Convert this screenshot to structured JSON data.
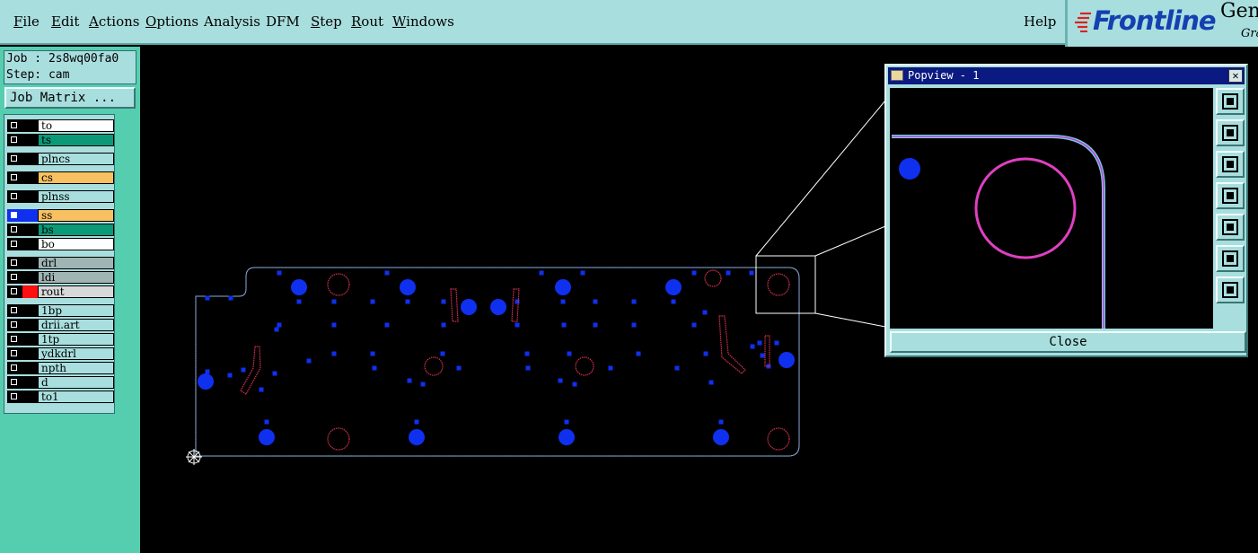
{
  "menu": {
    "items": [
      {
        "label": "File",
        "key": "F"
      },
      {
        "label": "Edit",
        "key": "E"
      },
      {
        "label": "Actions",
        "key": "A"
      },
      {
        "label": "Options",
        "key": "O"
      },
      {
        "label": "Analysis",
        "key": ""
      },
      {
        "label": "DFM",
        "key": ""
      },
      {
        "label": "Step",
        "key": "S"
      },
      {
        "label": "Rout",
        "key": "R"
      },
      {
        "label": "Windows",
        "key": "W"
      }
    ],
    "help": "Help"
  },
  "logo": {
    "brand": "Frontline",
    "product": "Gen",
    "sub": "Gra"
  },
  "job": {
    "job_line": "Job : 2s8wq00fa0",
    "step_line": "Step: cam"
  },
  "job_matrix_button": "Job Matrix ...",
  "layers": [
    {
      "name": "to",
      "color": "#ffffff",
      "swatch": "#000000",
      "checked": false
    },
    {
      "name": "ts",
      "color": "#0a9a78",
      "swatch": "#000000",
      "checked": false
    },
    {
      "name": "plncs",
      "color": "#a9dede",
      "swatch": "#000000",
      "checked": false
    },
    {
      "name": "cs",
      "color": "#f8c060",
      "swatch": "#000000",
      "checked": false
    },
    {
      "name": "plnss",
      "color": "#a9dede",
      "swatch": "#000000",
      "checked": false
    },
    {
      "name": "ss",
      "color": "#f8c060",
      "swatch": "#1030f0",
      "checked": true
    },
    {
      "name": "bs",
      "color": "#0a9a78",
      "swatch": "#000000",
      "checked": false
    },
    {
      "name": "bo",
      "color": "#ffffff",
      "swatch": "#000000",
      "checked": false
    },
    {
      "name": "drl",
      "color": "#a0b4b4",
      "swatch": "#000000",
      "checked": false
    },
    {
      "name": "ldi",
      "color": "#a0b4b4",
      "swatch": "#000000",
      "checked": false
    },
    {
      "name": "rout",
      "color": "#d8d8d8",
      "swatch": "#ff1010",
      "checked": false
    },
    {
      "name": "1bp",
      "color": "#a9dede",
      "swatch": "#000000",
      "checked": false
    },
    {
      "name": "drii.art",
      "color": "#a9dede",
      "swatch": "#000000",
      "checked": false
    },
    {
      "name": "1tp",
      "color": "#a9dede",
      "swatch": "#000000",
      "checked": false
    },
    {
      "name": "ydkdrl",
      "color": "#a9dede",
      "swatch": "#000000",
      "checked": false
    },
    {
      "name": "npth",
      "color": "#a9dede",
      "swatch": "#000000",
      "checked": false
    },
    {
      "name": "d",
      "color": "#a9dede",
      "swatch": "#000000",
      "checked": false
    },
    {
      "name": "to1",
      "color": "#a9dede",
      "swatch": "#000000",
      "checked": false
    }
  ],
  "popview": {
    "title": "Popview - 1",
    "close_x": "✕",
    "close_button": "Close",
    "tools": [
      "zoom-fit-icon",
      "pan-up-icon",
      "pan-down-icon",
      "pan-left-icon",
      "pan-right-icon",
      "zoom-in-icon",
      "zoom-out-icon"
    ]
  },
  "colors": {
    "ui_panel": "#a9dede",
    "left_panel": "#55ceb0",
    "pad_blue": "#1030f0",
    "rout_red": "#d0304c",
    "outline_cyan": "#6ad6e6"
  }
}
